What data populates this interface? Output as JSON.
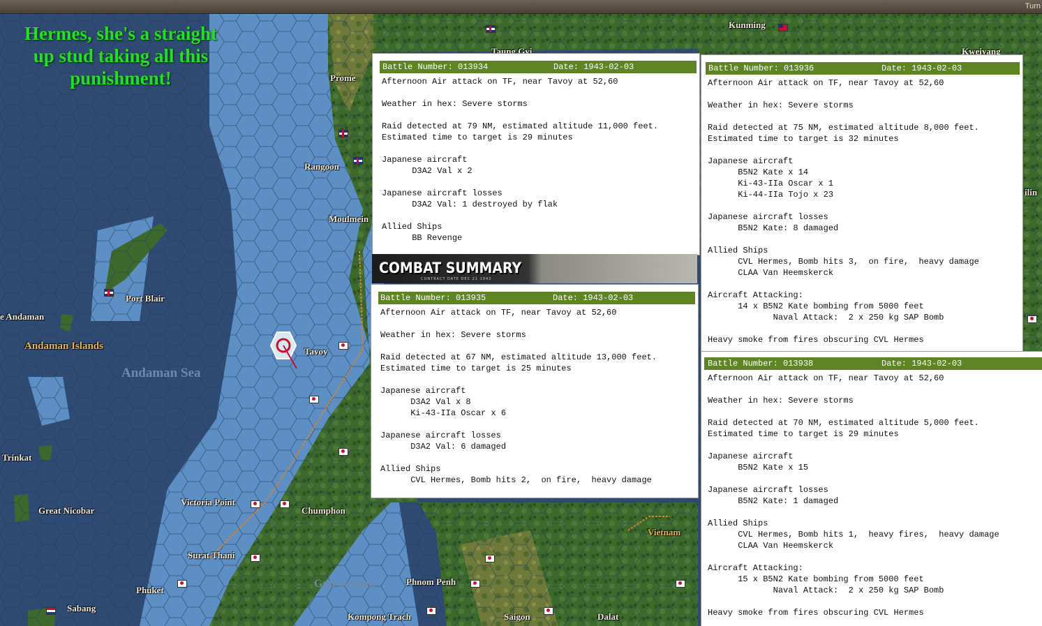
{
  "window": {
    "corner_label": "Turn"
  },
  "caption": "Hermes, she's a straight up stud taking all this punishment!",
  "places": [
    {
      "name": "Kunming",
      "style": "land"
    },
    {
      "name": "Taung Gyi",
      "style": "land"
    },
    {
      "name": "Kweiyang",
      "style": "land"
    },
    {
      "name": "Prome",
      "style": "land"
    },
    {
      "name": "Rangoon",
      "style": "land"
    },
    {
      "name": "Moulmein",
      "style": "land"
    },
    {
      "name": "Port Blair",
      "style": "land"
    },
    {
      "name": "e Andaman",
      "style": "land"
    },
    {
      "name": "Andaman Islands",
      "style": "gold"
    },
    {
      "name": "Andaman Sea",
      "style": "sea"
    },
    {
      "name": "Tavoy",
      "style": "land"
    },
    {
      "name": "Trinkat",
      "style": "land"
    },
    {
      "name": "Great Nicobar",
      "style": "land"
    },
    {
      "name": "Victoria Point",
      "style": "land"
    },
    {
      "name": "Chumphon",
      "style": "land"
    },
    {
      "name": "Surat Thani",
      "style": "land"
    },
    {
      "name": "Phuket",
      "style": "land"
    },
    {
      "name": "Sabang",
      "style": "land"
    },
    {
      "name": "Gulf of Siam",
      "style": "sea"
    },
    {
      "name": "Phnom Penh",
      "style": "land"
    },
    {
      "name": "Kompong Trach",
      "style": "land"
    },
    {
      "name": "Saigon",
      "style": "land"
    },
    {
      "name": "Dalat",
      "style": "land"
    },
    {
      "name": "Vietnam",
      "style": "gold"
    },
    {
      "name": "ilin",
      "style": "land"
    }
  ],
  "combat_banner": {
    "title": "COMBAT SUMMARY",
    "subtitle": "CONTRACT DATE DEC 21 1943"
  },
  "reports": [
    {
      "battle_number": "Battle Number: 013934",
      "date": "Date: 1943-02-03",
      "lines": [
        "Afternoon Air attack on TF, near Tavoy at 52,60",
        "",
        "Weather in hex: Severe storms",
        "",
        "Raid detected at 79 NM, estimated altitude 11,000 feet.",
        "Estimated time to target is 29 minutes",
        "",
        "Japanese aircraft",
        "      D3A2 Val x 2",
        "",
        "Japanese aircraft losses",
        "      D3A2 Val: 1 destroyed by flak",
        "",
        "Allied Ships",
        "      BB Revenge"
      ]
    },
    {
      "battle_number": "Battle Number: 013936",
      "date": "Date: 1943-02-03",
      "lines": [
        "Afternoon Air attack on TF, near Tavoy at 52,60",
        "",
        "Weather in hex: Severe storms",
        "",
        "Raid detected at 75 NM, estimated altitude 8,000 feet.",
        "Estimated time to target is 32 minutes",
        "",
        "Japanese aircraft",
        "      B5N2 Kate x 14",
        "      Ki-43-IIa Oscar x 1",
        "      Ki-44-IIa Tojo x 23",
        "",
        "Japanese aircraft losses",
        "      B5N2 Kate: 8 damaged",
        "",
        "Allied Ships",
        "      CVL Hermes, Bomb hits 3,  on fire,  heavy damage",
        "      CLAA Van Heemskerck",
        "",
        "Aircraft Attacking:",
        "      14 x B5N2 Kate bombing from 5000 feet",
        "             Naval Attack:  2 x 250 kg SAP Bomb",
        "",
        "Heavy smoke from fires obscuring CVL Hermes"
      ]
    },
    {
      "battle_number": "Battle Number: 013935",
      "date": "Date: 1943-02-03",
      "lines": [
        "Afternoon Air attack on TF, near Tavoy at 52,60",
        "",
        "Weather in hex: Severe storms",
        "",
        "Raid detected at 67 NM, estimated altitude 13,000 feet.",
        "Estimated time to target is 25 minutes",
        "",
        "Japanese aircraft",
        "      D3A2 Val x 8",
        "      Ki-43-IIa Oscar x 6",
        "",
        "Japanese aircraft losses",
        "      D3A2 Val: 6 damaged",
        "",
        "Allied Ships",
        "      CVL Hermes, Bomb hits 2,  on fire,  heavy damage"
      ]
    },
    {
      "battle_number": "Battle Number: 013938",
      "date": "Date: 1943-02-03",
      "lines": [
        "Afternoon Air attack on TF, near Tavoy at 52,60",
        "",
        "Weather in hex: Severe storms",
        "",
        "Raid detected at 70 NM, estimated altitude 5,000 feet.",
        "Estimated time to target is 29 minutes",
        "",
        "Japanese aircraft",
        "      B5N2 Kate x 15",
        "",
        "Japanese aircraft losses",
        "      B5N2 Kate: 1 damaged",
        "",
        "Allied Ships",
        "      CVL Hermes, Bomb hits 1,  heavy fires,  heavy damage",
        "      CLAA Van Heemskerck",
        "",
        "Aircraft Attacking:",
        "      15 x B5N2 Kate bombing from 5000 feet",
        "             Naval Attack:  2 x 250 kg SAP Bomb",
        "",
        "Heavy smoke from fires obscuring CVL Hermes"
      ]
    }
  ],
  "colors": {
    "sea_deep": "#2f4a73",
    "sea_shallow": "#5d8fc4",
    "land": "#3f6b2e",
    "header": "#5e8424",
    "caption": "#22e022"
  }
}
